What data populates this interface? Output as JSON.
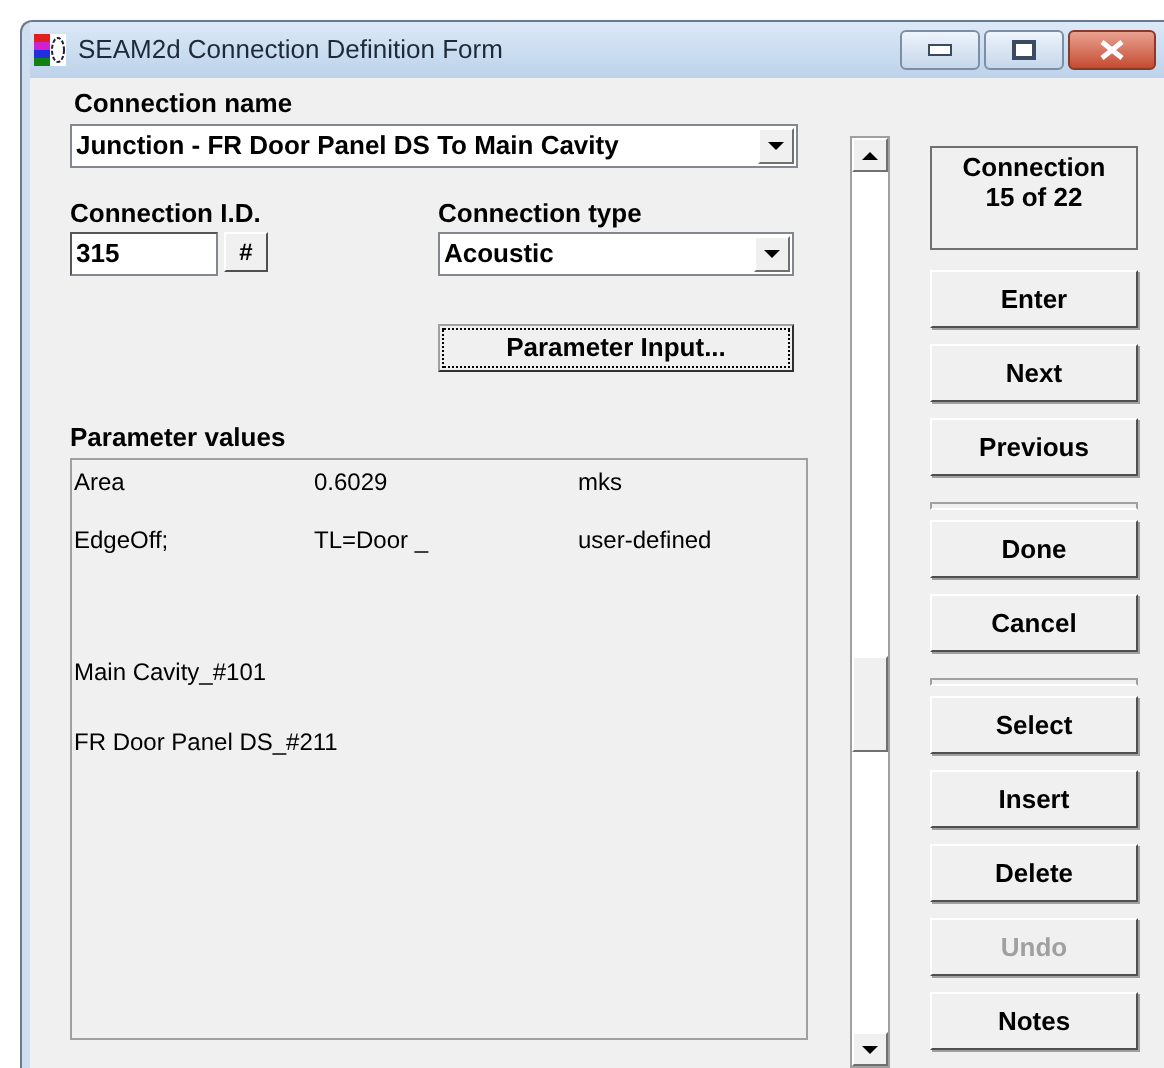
{
  "window": {
    "title": "SEAM2d Connection Definition Form"
  },
  "connection_name": {
    "label": "Connection name",
    "value": "Junction - FR Door Panel DS To Main Cavity"
  },
  "connection_id": {
    "label": "Connection I.D.",
    "value": "315",
    "button": "#"
  },
  "connection_type": {
    "label": "Connection type",
    "value": "Acoustic"
  },
  "parameter_input_button": {
    "label": "Parameter Input...",
    "focused": true
  },
  "parameter_values": {
    "label": "Parameter values",
    "rows": [
      {
        "cells": [
          "Area",
          "0.6029",
          "mks"
        ]
      },
      {
        "cells": [
          "EdgeOff;",
          "TL=Door _",
          "user-defined"
        ]
      }
    ],
    "subsystems": [
      "Main Cavity_#101",
      "FR Door Panel DS_#211"
    ]
  },
  "counter": "Connection\n15 of  22",
  "button_groups": [
    [
      {
        "label": "Enter",
        "disabled": false
      },
      {
        "label": "Next",
        "disabled": false
      },
      {
        "label": "Previous",
        "disabled": false
      }
    ],
    [
      {
        "label": "Done",
        "disabled": false
      },
      {
        "label": "Cancel",
        "disabled": false
      }
    ],
    [
      {
        "label": "Select",
        "disabled": false
      },
      {
        "label": "Insert",
        "disabled": false
      },
      {
        "label": "Delete",
        "disabled": false
      },
      {
        "label": "Undo",
        "disabled": true
      },
      {
        "label": "Notes",
        "disabled": false
      }
    ]
  ]
}
